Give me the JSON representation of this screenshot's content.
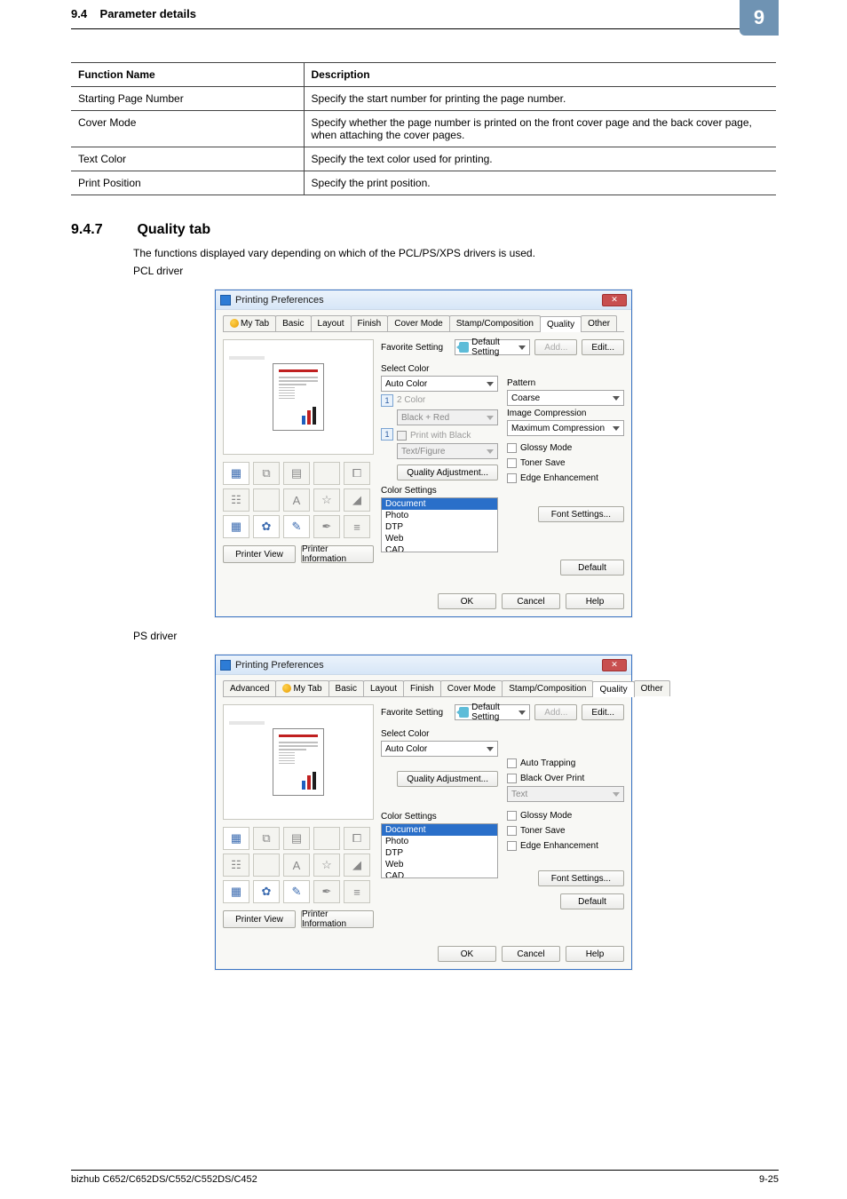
{
  "header": {
    "section_num": "9.4",
    "section_title": "Parameter details",
    "chapter_badge": "9"
  },
  "table": {
    "head_col1": "Function Name",
    "head_col2": "Description",
    "rows": [
      {
        "name": "Starting Page Number",
        "desc": "Specify the start number for printing the page number."
      },
      {
        "name": "Cover Mode",
        "desc": "Specify whether the page number is printed on the front cover page and the back cover page, when attaching the cover pages."
      },
      {
        "name": "Text Color",
        "desc": "Specify the text color used for printing."
      },
      {
        "name": "Print Position",
        "desc": "Specify the print position."
      }
    ]
  },
  "quality": {
    "num": "9.4.7",
    "title": "Quality tab",
    "p1": "The functions displayed vary depending on which of the PCL/PS/XPS drivers is used.",
    "p2": "PCL driver",
    "p3": "PS driver"
  },
  "pcl": {
    "title": "Printing Preferences",
    "close": "✕",
    "tabs": {
      "mytab": "My Tab",
      "basic": "Basic",
      "layout": "Layout",
      "finish": "Finish",
      "covermode": "Cover Mode",
      "stamp": "Stamp/Composition",
      "quality": "Quality",
      "other": "Other"
    },
    "fav_label": "Favorite Setting",
    "fav_value": "Default Setting",
    "add_btn": "Add...",
    "edit_btn": "Edit...",
    "select_color_label": "Select Color",
    "select_color_value": "Auto Color",
    "twocolor_label": "2 Color",
    "twocolor_value": "Black + Red",
    "print_with_black": "Print with Black",
    "textfigure_label": "Text/Figure",
    "qa_btn": "Quality Adjustment...",
    "colorsettings_label": "Color Settings",
    "cs_items": {
      "doc": "Document",
      "photo": "Photo",
      "dtp": "DTP",
      "web": "Web",
      "cad": "CAD"
    },
    "pattern_label": "Pattern",
    "pattern_value": "Coarse",
    "imagecomp_label": "Image Compression",
    "imagecomp_value": "Maximum Compression",
    "glossy": "Glossy Mode",
    "toner": "Toner Save",
    "edge": "Edge Enhancement",
    "font_btn": "Font Settings...",
    "printerview": "Printer View",
    "printerinfo": "Printer Information",
    "default_btn": "Default",
    "ok": "OK",
    "cancel": "Cancel",
    "help": "Help"
  },
  "ps": {
    "title": "Printing Preferences",
    "close": "✕",
    "tabs": {
      "advanced": "Advanced",
      "mytab": "My Tab",
      "basic": "Basic",
      "layout": "Layout",
      "finish": "Finish",
      "covermode": "Cover Mode",
      "stamp": "Stamp/Composition",
      "quality": "Quality",
      "other": "Other"
    },
    "fav_label": "Favorite Setting",
    "fav_value": "Default Setting",
    "add_btn": "Add...",
    "edit_btn": "Edit...",
    "select_color_label": "Select Color",
    "select_color_value": "Auto Color",
    "qa_btn": "Quality Adjustment...",
    "colorsettings_label": "Color Settings",
    "cs_items": {
      "doc": "Document",
      "photo": "Photo",
      "dtp": "DTP",
      "web": "Web",
      "cad": "CAD"
    },
    "autotrap": "Auto Trapping",
    "bop": "Black Over Print",
    "bop_value": "Text",
    "glossy": "Glossy Mode",
    "toner": "Toner Save",
    "edge": "Edge Enhancement",
    "font_btn": "Font Settings...",
    "printerview": "Printer View",
    "printerinfo": "Printer Information",
    "default_btn": "Default",
    "ok": "OK",
    "cancel": "Cancel",
    "help": "Help"
  },
  "footer": {
    "model": "bizhub C652/C652DS/C552/C552DS/C452",
    "page": "9-25"
  }
}
